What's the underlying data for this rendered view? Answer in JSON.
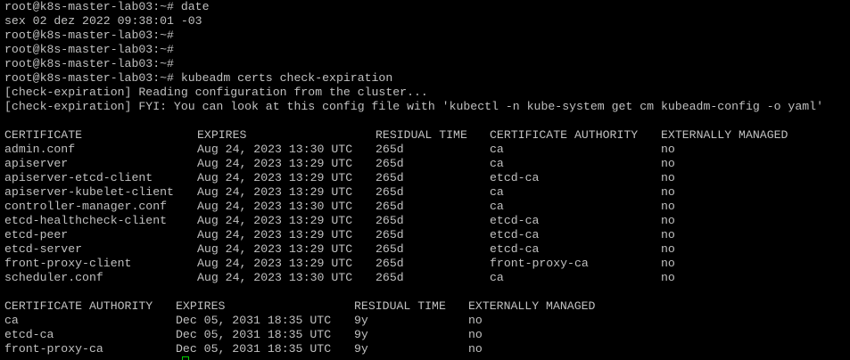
{
  "session": {
    "lines": [
      "root@k8s-master-lab03:~# date",
      "sex 02 dez 2022 09:38:01 -03",
      "root@k8s-master-lab03:~#",
      "root@k8s-master-lab03:~#",
      "root@k8s-master-lab03:~#",
      "root@k8s-master-lab03:~# kubeadm certs check-expiration",
      "[check-expiration] Reading configuration from the cluster...",
      "[check-expiration] FYI: You can look at this config file with 'kubectl -n kube-system get cm kubeadm-config -o yaml'"
    ]
  },
  "certificates_table": {
    "headers": [
      "CERTIFICATE",
      "EXPIRES",
      "RESIDUAL TIME",
      "CERTIFICATE AUTHORITY",
      "EXTERNALLY MANAGED"
    ],
    "rows": [
      [
        "admin.conf",
        "Aug 24, 2023 13:30 UTC",
        "265d",
        "ca",
        "no"
      ],
      [
        "apiserver",
        "Aug 24, 2023 13:29 UTC",
        "265d",
        "ca",
        "no"
      ],
      [
        "apiserver-etcd-client",
        "Aug 24, 2023 13:29 UTC",
        "265d",
        "etcd-ca",
        "no"
      ],
      [
        "apiserver-kubelet-client",
        "Aug 24, 2023 13:29 UTC",
        "265d",
        "ca",
        "no"
      ],
      [
        "controller-manager.conf",
        "Aug 24, 2023 13:30 UTC",
        "265d",
        "ca",
        "no"
      ],
      [
        "etcd-healthcheck-client",
        "Aug 24, 2023 13:29 UTC",
        "265d",
        "etcd-ca",
        "no"
      ],
      [
        "etcd-peer",
        "Aug 24, 2023 13:29 UTC",
        "265d",
        "etcd-ca",
        "no"
      ],
      [
        "etcd-server",
        "Aug 24, 2023 13:29 UTC",
        "265d",
        "etcd-ca",
        "no"
      ],
      [
        "front-proxy-client",
        "Aug 24, 2023 13:29 UTC",
        "265d",
        "front-proxy-ca",
        "no"
      ],
      [
        "scheduler.conf",
        "Aug 24, 2023 13:30 UTC",
        "265d",
        "ca",
        "no"
      ]
    ]
  },
  "authorities_table": {
    "headers": [
      "CERTIFICATE AUTHORITY",
      "EXPIRES",
      "RESIDUAL TIME",
      "EXTERNALLY MANAGED"
    ],
    "rows": [
      [
        "ca",
        "Dec 05, 2031 18:35 UTC",
        "9y",
        "no"
      ],
      [
        "etcd-ca",
        "Dec 05, 2031 18:35 UTC",
        "9y",
        "no"
      ],
      [
        "front-proxy-ca",
        "Dec 05, 2031 18:35 UTC",
        "9y",
        "no"
      ]
    ]
  },
  "colors": {
    "background": "#000000",
    "text": "#c0c0c0",
    "cursor": "#00d000"
  }
}
